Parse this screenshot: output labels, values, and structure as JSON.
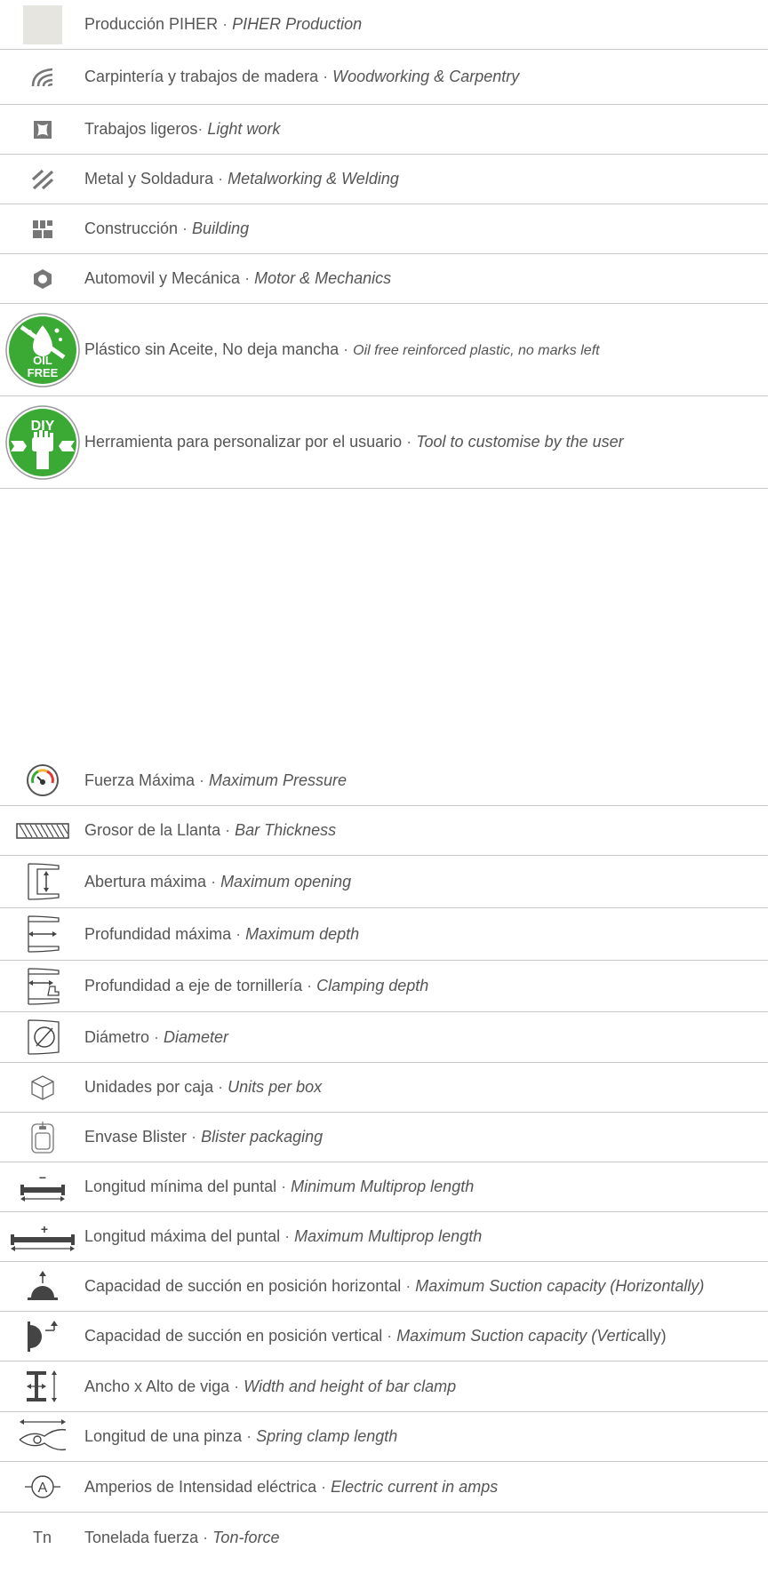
{
  "sectors": [
    {
      "icon": "piher-production-swatch-icon",
      "es": "Producción PIHER",
      "sep": " · ",
      "en": "PIHER Production"
    },
    {
      "icon": "woodworking-icon",
      "es": "Carpintería y trabajos de madera",
      "sep": " · ",
      "en": "Woodworking & Carpentry"
    },
    {
      "icon": "light-work-icon",
      "es": "Trabajos ligeros",
      "sep": "· ",
      "en": "Light work"
    },
    {
      "icon": "metalworking-icon",
      "es": "Metal y Soldadura",
      "sep": " · ",
      "en": "Metalworking & Welding"
    },
    {
      "icon": "building-icon",
      "es": "Construcción",
      "sep": " · ",
      "en": "Building"
    },
    {
      "icon": "motor-mechanics-icon",
      "es": "Automovil y Mecánica",
      "sep": " · ",
      "en": "Motor & Mechanics"
    },
    {
      "icon": "oil-free-badge-icon",
      "badge": [
        "OIL",
        "FREE"
      ],
      "es": "Plástico sin Aceite, No deja mancha",
      "sep": " · ",
      "en": "Oil free reinforced plastic, no marks left"
    },
    {
      "icon": "diy-badge-icon",
      "badge": [
        "DIY"
      ],
      "es": "Herramienta para personalizar por el usuario",
      "sep": " · ",
      "en": "Tool to customise by the user"
    }
  ],
  "specs": [
    {
      "icon": "pressure-gauge-icon",
      "es": "Fuerza Máxima",
      "sep": " · ",
      "en": "Maximum Pressure"
    },
    {
      "icon": "bar-thickness-icon",
      "es": "Grosor de la Llanta",
      "sep": " · ",
      "en": "Bar Thickness"
    },
    {
      "icon": "max-opening-icon",
      "es": "Abertura máxima",
      "sep": " · ",
      "en": "Maximum opening"
    },
    {
      "icon": "max-depth-icon",
      "es": "Profundidad máxima",
      "sep": " · ",
      "en": "Maximum depth"
    },
    {
      "icon": "clamping-depth-icon",
      "es": "Profundidad a eje de tornillería",
      "sep": " · ",
      "en": "Clamping depth"
    },
    {
      "icon": "diameter-icon",
      "es": "Diámetro",
      "sep": " · ",
      "en": "Diameter"
    },
    {
      "icon": "units-per-box-icon",
      "es": "Unidades por caja",
      "sep": " · ",
      "en": "Units per box"
    },
    {
      "icon": "blister-packaging-icon",
      "es": "Envase Blister",
      "sep": " · ",
      "en": "Blister packaging"
    },
    {
      "icon": "min-multiprop-length-icon",
      "es": "Longitud mínima del puntal",
      "sep": " · ",
      "en": "Minimum Multiprop length",
      "glyph": "−"
    },
    {
      "icon": "max-multiprop-length-icon",
      "es": "Longitud máxima del puntal",
      "sep": " · ",
      "en": "Maximum Multiprop length",
      "glyph": "+"
    },
    {
      "icon": "suction-horizontal-icon",
      "es": "Capacidad de succión en posición horizontal",
      "sep": " · ",
      "en": "Maximum Suction capacity (Horizontally)"
    },
    {
      "icon": "suction-vertical-icon",
      "es": "Capacidad de succión en posición vertical",
      "sep": " · ",
      "en": "Maximum Suction capacity (Vertic",
      "en_tail": "ally)"
    },
    {
      "icon": "bar-clamp-width-height-icon",
      "es": "Ancho x Alto de viga",
      "sep": " · ",
      "en": "Width and height of bar clamp"
    },
    {
      "icon": "spring-clamp-length-icon",
      "es": "Longitud de una pinza",
      "sep": " · ",
      "en": "Spring clamp length"
    },
    {
      "icon": "amperes-icon",
      "es": "Amperios de Intensidad eléctrica",
      "sep": " · ",
      "en": "Electric current in amps",
      "glyph": "A"
    },
    {
      "icon": "ton-force-icon",
      "es": "Tonelada fuerza",
      "sep": " · ",
      "en": "Ton-force",
      "glyph": "Tn"
    }
  ]
}
